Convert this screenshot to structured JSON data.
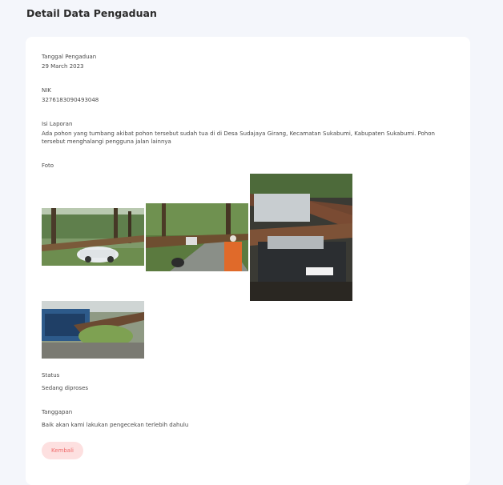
{
  "page": {
    "title": "Detail Data Pengaduan"
  },
  "details": {
    "date_label": "Tanggal Pengaduan",
    "date_value": "29 March 2023",
    "nik_label": "NIK",
    "nik_value": "3276183090493048",
    "report_label": "Isi Laporan",
    "report_value": "Ada pohon yang tumbang akibat pohon tersebut sudah tua di di Desa Sudajaya Girang, Kecamatan Sukabumi, Kabupaten Sukabumi. Pohon tersebut menghalangi pengguna jalan lainnya",
    "photo_label": "Foto",
    "status_label": "Status",
    "status_value": "Sedang diproses",
    "response_label": "Tanggapan",
    "response_value": "Baik akan kami lakukan pengecekan terlebih dahulu"
  },
  "photos": [
    {
      "name": "photo-fallen-tree-on-white-car"
    },
    {
      "name": "photo-fallen-tree-on-road"
    },
    {
      "name": "photo-crushed-car-closeup"
    },
    {
      "name": "photo-fallen-tree-on-stall"
    }
  ],
  "actions": {
    "back_label": "Kembali"
  }
}
